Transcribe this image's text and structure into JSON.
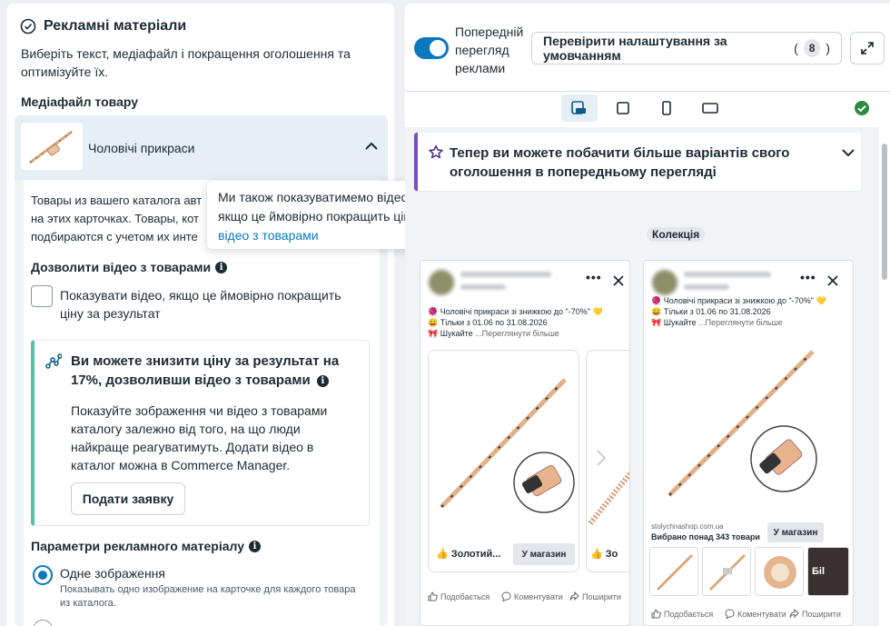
{
  "left": {
    "title": "Рекламні матеріали",
    "description": "Виберіть текст, медіафайл і покращення оголошення та оптимізуйте їх.",
    "media_section": "Медіафайл товару",
    "product_set": "Чоловічі прикраси",
    "catalog_text": "Товары из вашего каталога авт на этих карточках. Товары, кот подбираются с учетом их инте",
    "allow_video_title": "Дозволити відео з товарами",
    "allow_video_checkbox": "Показувати відео, якщо це ймовірно покращить ціну за результат",
    "promo": {
      "headline": "Ви можете знизити ціну за результат на 17%, дозволивши відео з товарами",
      "body": "Показуйте зображення чи відео з товарами каталогу залежно від того, на що люди найкраще реагуватимуть. Додати відео в каталог можна в Commerce Manager.",
      "button": "Подати заявку"
    },
    "params_title": "Параметри рекламного матеріалу",
    "option_single": "Одне зображення",
    "option_single_desc": "Показывать одно изображение на карточке для каждого товара из каталога."
  },
  "tooltip": {
    "text": "Ми також показуватимемо відео з вашого каталогу, якщо це ймовірно покращить ціну за результат.",
    "link": "Про відео з товарами"
  },
  "right": {
    "toggle_label": "Попередній перегляд реклами",
    "toggle_on": true,
    "check_button": "Перевірити налаштування за умовчанням",
    "check_count": "8",
    "notice": "Тепер ви можете побачити більше варіантів свого оголошення в попередньому перегляді",
    "collection_badge": "Колекція"
  },
  "ad_left": {
    "line1": "🧶 Чоловічі прикраси зі знижкою до \"-70%\" 💛",
    "line2": "😄 Тільки з 01.06 по 31.08.2026",
    "line3": "🎀 Шукайте",
    "see_more": "...Переглянути більше",
    "card_title": "👍 Золотий...",
    "card_title2": "👍 Зо",
    "shop_button": "У магазин",
    "like": "Подобається",
    "comment": "Коментувати",
    "share": "Поширити"
  },
  "ad_right": {
    "line1": "🧶 Чоловічі прикраси зі знижкою до \"-70%\" 💛",
    "line2": "😄 Тільки з 01.06 по 31.08.2026",
    "line3": "🎀 Шукайте",
    "see_more": "...Переглянути більше",
    "domain": "stolychnashop.com.ua",
    "products_count": "Вибрано понад 343 товари",
    "shop_button": "У магазин",
    "thumb_label": "Бil",
    "like": "Подобається",
    "comment": "Коментувати",
    "share": "Поширити"
  },
  "colors": {
    "accent": "#0a78be",
    "promo_border": "#55bfa8",
    "notice_border": "#7a4dc2",
    "success": "#2a8a3e"
  }
}
